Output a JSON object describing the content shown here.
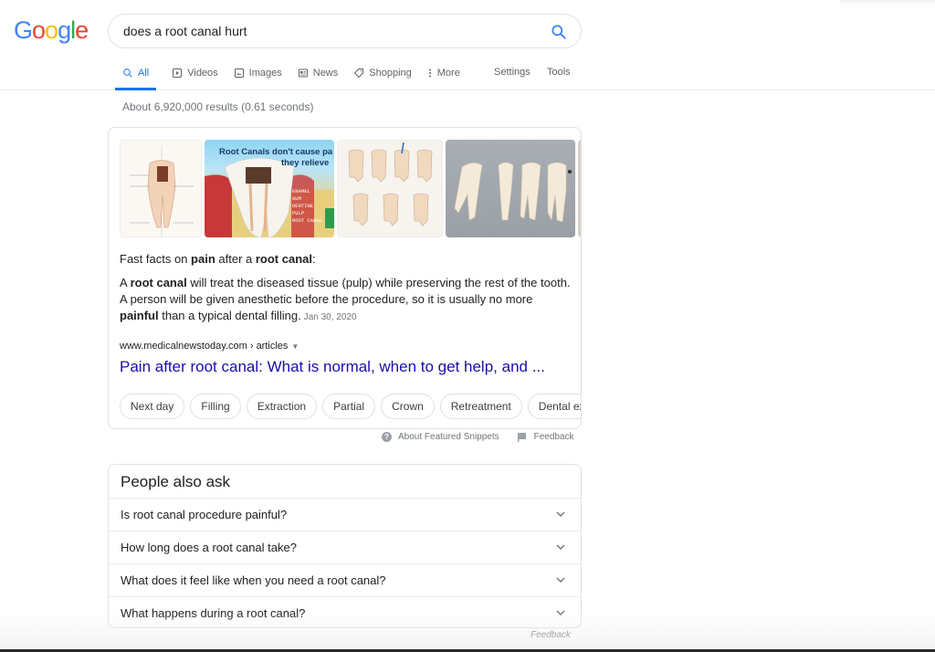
{
  "logo": {
    "letters": [
      "G",
      "o",
      "o",
      "g",
      "l",
      "e"
    ],
    "colors": [
      "#4285f4",
      "#ea4335",
      "#fbbc05",
      "#4285f4",
      "#34a853",
      "#ea4335"
    ]
  },
  "search": {
    "query": "does a root canal hurt",
    "placeholder": ""
  },
  "tabs": [
    {
      "label": "All",
      "icon": "search-icon",
      "active": true
    },
    {
      "label": "Videos",
      "icon": "play-icon"
    },
    {
      "label": "Images",
      "icon": "image-icon"
    },
    {
      "label": "News",
      "icon": "news-icon"
    },
    {
      "label": "Shopping",
      "icon": "tag-icon"
    },
    {
      "label": "More",
      "icon": "more-vert-icon"
    }
  ],
  "tools": {
    "settings": "Settings",
    "tools": "Tools"
  },
  "result_stats": "About 6,920,000 results (0.61 seconds)",
  "snippet": {
    "images": [
      {
        "alt": "Infected pulp tissue diagram"
      },
      {
        "alt": "Root Canals don't cause pain, they relieve it",
        "caption_line1": "Root Canals don't cause pa",
        "caption_line2": "they relieve",
        "labels": [
          "ENAMEL",
          "GUM",
          "DENTINE",
          "PULP",
          "ROOT CANAL"
        ]
      },
      {
        "alt": "Root canal therapy steps diagram"
      },
      {
        "alt": "Extracted teeth photo"
      },
      {
        "alt": "Tooth photo"
      }
    ],
    "lead": {
      "pre": "Fast facts on ",
      "b1": "pain",
      "mid": " after a ",
      "b2": "root canal",
      "post": ":"
    },
    "body": {
      "p1": "A ",
      "b1": "root canal",
      "p2": " will treat the diseased tissue (pulp) while preserving the rest of the tooth. A person will be given anesthetic before the procedure, so it is usually no more ",
      "b2": "painful",
      "p3": " than a typical dental filling.",
      "date": "Jan 30, 2020"
    },
    "url": "www.medicalnewstoday.com › articles",
    "title": "Pain after root canal: What is normal, when to get help, and ...",
    "chips": [
      "Next day",
      "Filling",
      "Extraction",
      "Partial",
      "Crown",
      "Retreatment",
      "Dental extraction"
    ],
    "footer": {
      "about": "About Featured Snippets",
      "feedback": "Feedback"
    }
  },
  "people_also_ask": {
    "title": "People also ask",
    "questions": [
      "Is root canal procedure painful?",
      "How long does a root canal take?",
      "What does it feel like when you need a root canal?",
      "What happens during a root canal?"
    ],
    "feedback": "Feedback"
  },
  "colors": {
    "accent": "#1a73e8",
    "link": "#1a0dab",
    "muted": "#70757a"
  }
}
